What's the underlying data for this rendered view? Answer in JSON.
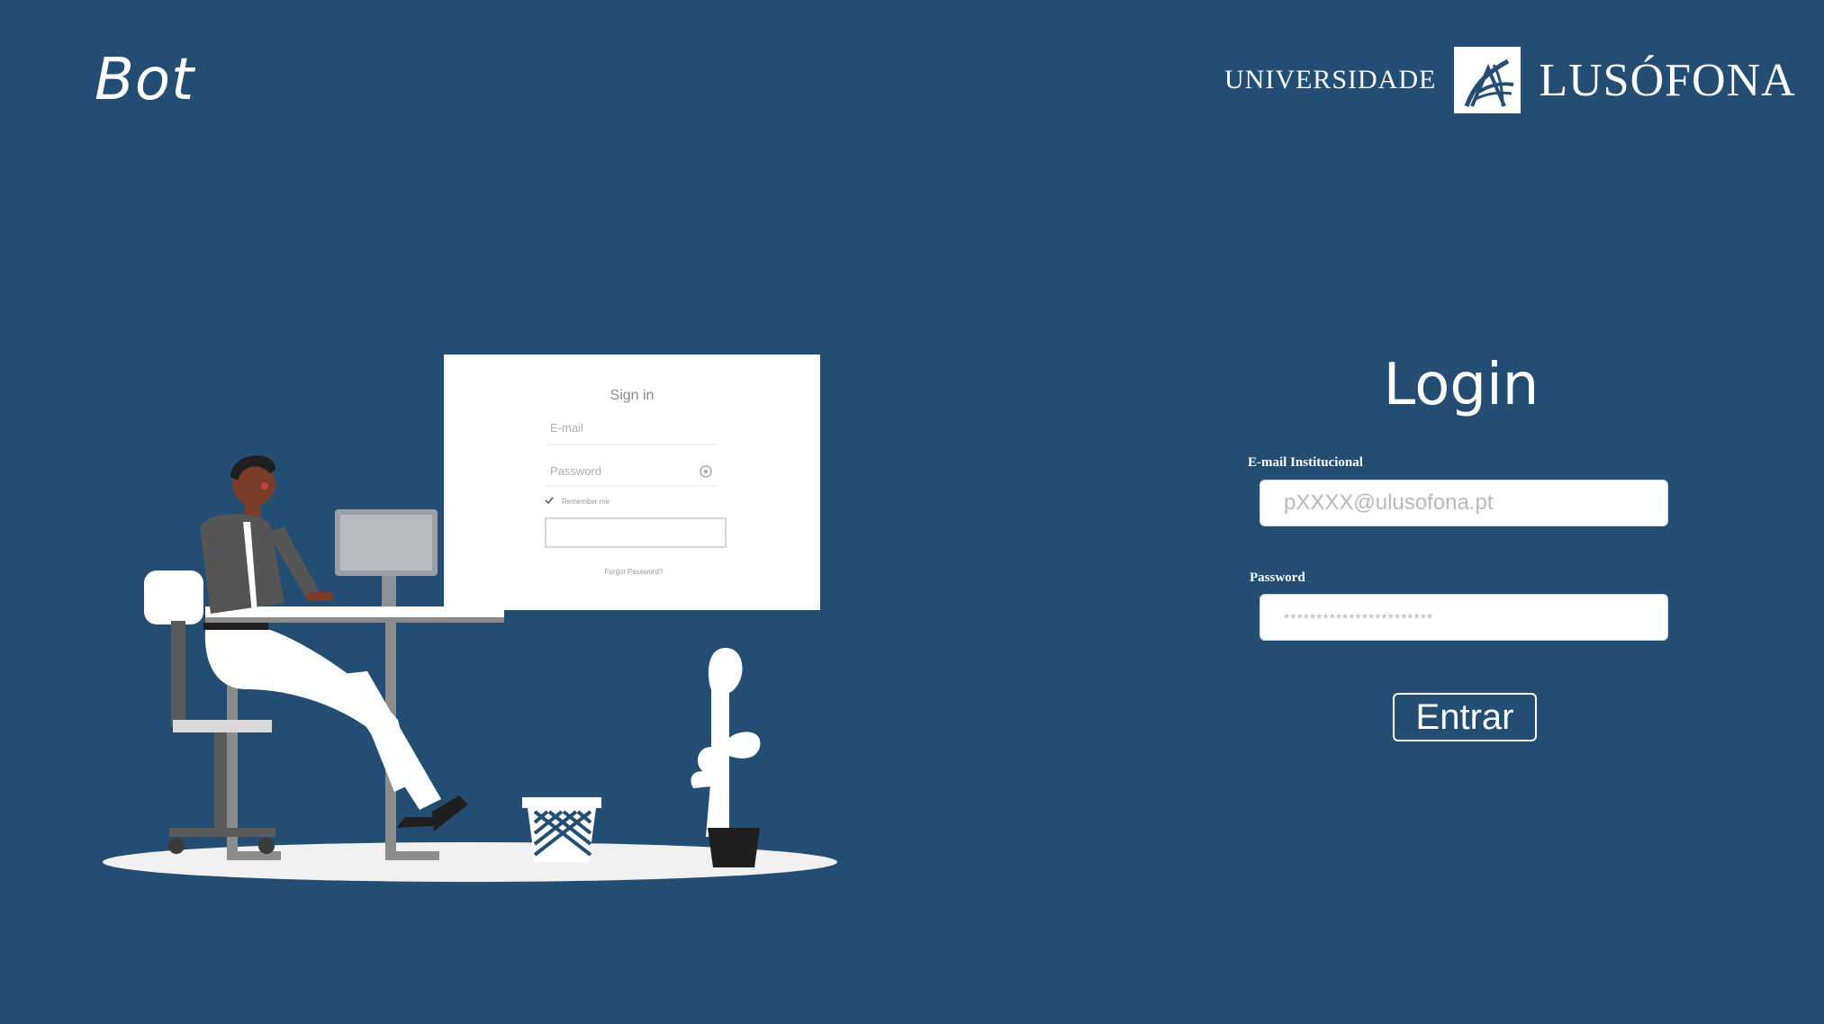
{
  "header": {
    "brand": "Bot",
    "logo": {
      "left_text": "UNIVERSIDADE",
      "right_text": "LUSÓFONA",
      "icon": "lusofona-emblem-icon"
    }
  },
  "illustration": {
    "card_title": "Sign in",
    "email_placeholder": "E-mail",
    "password_placeholder": "Password",
    "remember_label": "Remember me",
    "forgot_link": "Forgot Password?"
  },
  "login": {
    "title": "Login",
    "email": {
      "label": "E-mail Institucional",
      "placeholder": "pXXXX@ulusofona.pt",
      "value": ""
    },
    "password": {
      "label": "Password",
      "placeholder": "***********************",
      "value": ""
    },
    "submit_label": "Entrar"
  },
  "colors": {
    "background": "#234d72",
    "foreground": "#ffffff",
    "input_background": "#ffffff",
    "placeholder": "#b9b9b9"
  }
}
